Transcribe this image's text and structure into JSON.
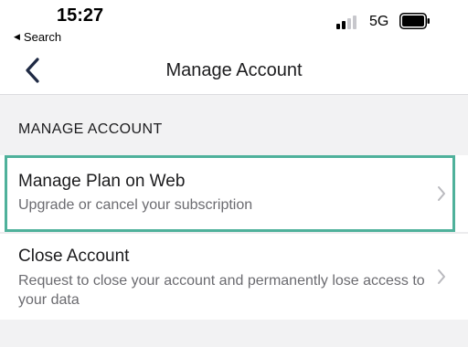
{
  "status_bar": {
    "time": "15:27",
    "back_app": "Search",
    "network": "5G"
  },
  "nav": {
    "title": "Manage Account",
    "back_icon": "chevron-left-icon"
  },
  "section": {
    "header": "MANAGE ACCOUNT"
  },
  "items": [
    {
      "title": "Manage Plan on Web",
      "subtitle": "Upgrade or cancel your subscription",
      "icon": "chevron-right-icon"
    },
    {
      "title": "Close Account",
      "subtitle": "Request to close your account and permanently lose access to your data",
      "icon": "chevron-right-icon"
    }
  ],
  "colors": {
    "highlight": "#4fb19b",
    "nav_tint": "#1f2a44",
    "background": "#f2f2f3"
  }
}
